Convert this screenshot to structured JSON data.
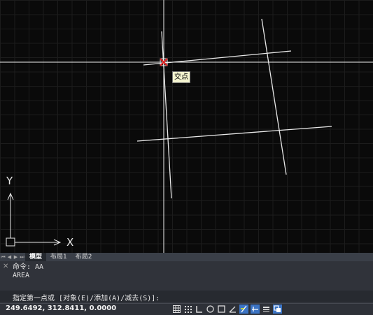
{
  "canvas": {
    "tooltip": "交点",
    "ucs_x_label": "X",
    "ucs_y_label": "Y"
  },
  "tabs": {
    "model": "模型",
    "layout1": "布局1",
    "layout2": "布局2"
  },
  "command": {
    "history": [
      "命令: AA",
      "AREA"
    ],
    "prompt": "指定第一点或 [对象(E)/添加(A)/减去(S)]:"
  },
  "status": {
    "coordinates": "249.6492, 312.8411, 0.0000",
    "icons": [
      "grid-icon",
      "snap-icon",
      "ortho-icon",
      "polar-icon",
      "osnap-icon",
      "otrack-icon",
      "dynucs-icon",
      "dynamic-input-icon",
      "lineweight-icon",
      "selection-cycling-icon"
    ]
  },
  "colors": {
    "canvas_bg": "#0a0a0a",
    "crosshair": "#ffffff",
    "snap_marker": "#e02020",
    "panel": "#30333a"
  }
}
